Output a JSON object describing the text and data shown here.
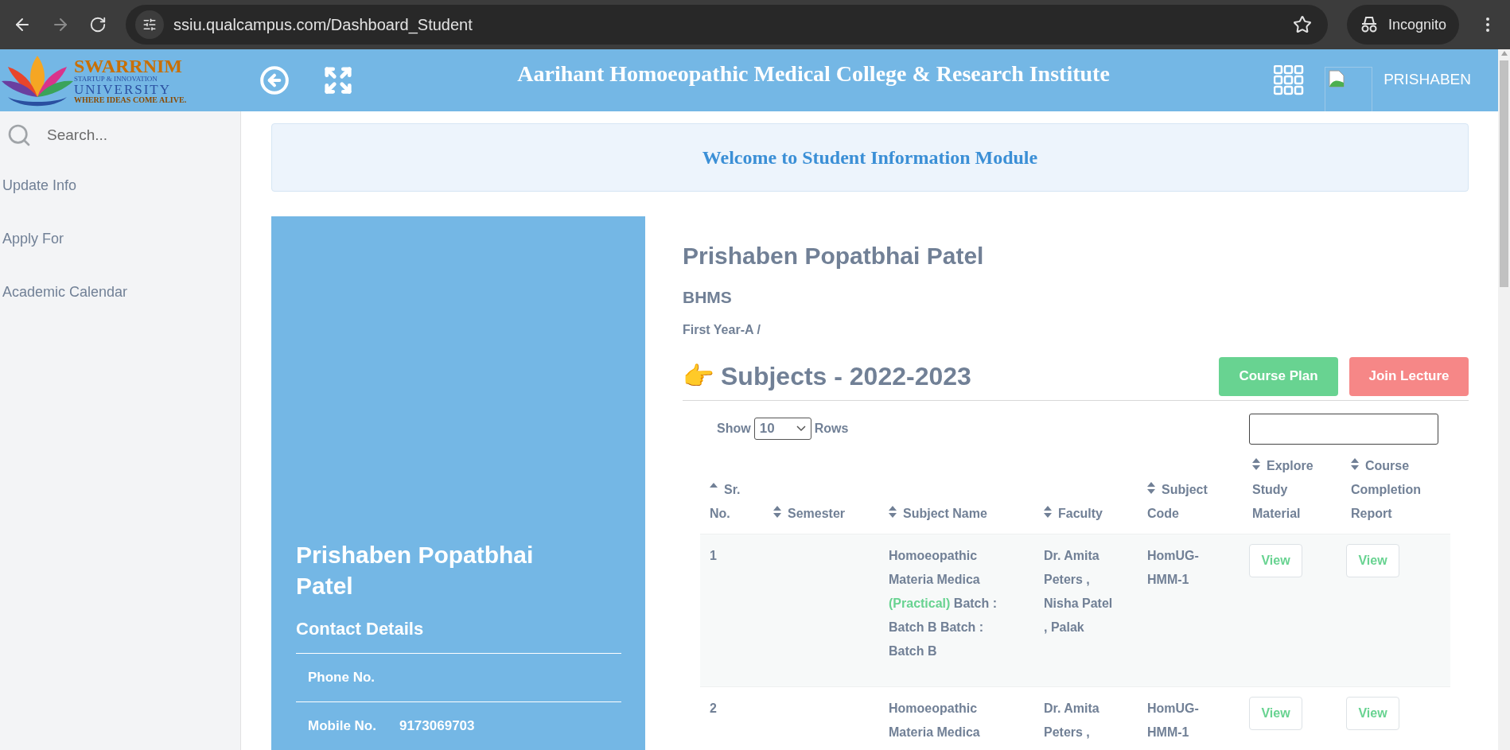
{
  "browser": {
    "url": "ssiu.qualcampus.com/Dashboard_Student",
    "profile": "Incognito"
  },
  "header": {
    "logo": {
      "name": "SWARRNIM",
      "line2": "STARTUP & INNOVATION",
      "line3": "UNIVERSITY",
      "tagline": "WHERE IDEAS COME ALIVE."
    },
    "title": "Aarihant Homoeopathic Medical College & Research Institute",
    "user": "PRISHABEN"
  },
  "sidebar": {
    "search": {
      "placeholder": "Search..."
    },
    "items": [
      {
        "label": "Update Info"
      },
      {
        "label": "Apply For"
      },
      {
        "label": "Academic Calendar"
      }
    ]
  },
  "welcome": "Welcome to Student Information Module",
  "profile_card": {
    "name": "Prishaben Popatbhai Patel",
    "section_title": "Contact Details",
    "fields": [
      {
        "label": "Phone No."
      },
      {
        "label": "Mobile No.",
        "value": "9173069703"
      }
    ]
  },
  "student": {
    "name": "Prishaben Popatbhai Patel",
    "program": "BHMS",
    "class": "First Year-A /"
  },
  "subjects": {
    "heading_icon": "👉",
    "heading": "Subjects - 2022-2023",
    "buttons": [
      {
        "label": "Course Plan",
        "kind": "success"
      },
      {
        "label": "Join Lecture",
        "kind": "danger"
      }
    ],
    "show": {
      "before": "Show",
      "value": "10",
      "after": "Rows"
    },
    "columns": [
      {
        "label": "Sr. No.",
        "sorted_ascending": true
      },
      {
        "label": "Semester",
        "sorted_ascending": false
      },
      {
        "label": "Subject Name",
        "sorted_ascending": false
      },
      {
        "label": "Faculty",
        "sorted_ascending": false
      },
      {
        "label": "Subject Code",
        "sorted_ascending": false
      },
      {
        "label": "Explore Study Material",
        "sorted_ascending": false
      },
      {
        "label": "Course Completion Report",
        "sorted_ascending": false
      }
    ],
    "rows": [
      {
        "sr": "1",
        "subject": [
          {
            "text": "Homoeopathic Materia Medica ",
            "highlight": false
          },
          {
            "text": "(Practical)",
            "highlight": true
          },
          {
            "text": " Batch : Batch B Batch : Batch B",
            "highlight": false
          }
        ],
        "faculty": "Dr. Amita Peters , Nisha Patel , Palak",
        "code": "HomUG-HMM-1",
        "explore": "View",
        "report": "View"
      },
      {
        "sr": "2",
        "subject": [
          {
            "text": "Homoeopathic Materia Medica",
            "highlight": false
          }
        ],
        "faculty": "Dr. Amita Peters ,",
        "code": "HomUG-HMM-1",
        "explore": "View",
        "report": "View"
      }
    ]
  }
}
